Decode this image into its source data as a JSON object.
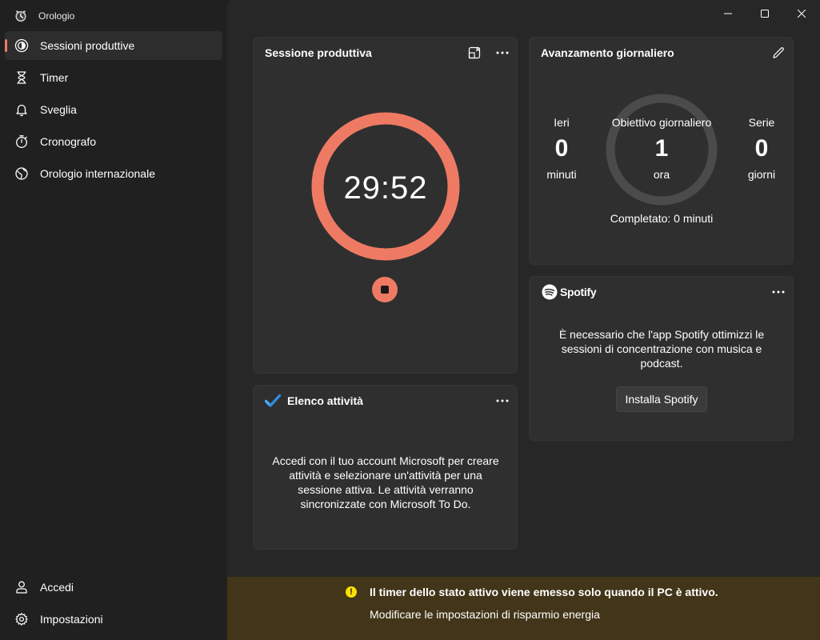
{
  "app": {
    "title": "Orologio"
  },
  "sidebar": {
    "items": [
      {
        "label": "Sessioni produttive",
        "icon": "focus-icon",
        "active": true
      },
      {
        "label": "Timer",
        "icon": "hourglass-icon"
      },
      {
        "label": "Sveglia",
        "icon": "bell-icon"
      },
      {
        "label": "Cronografo",
        "icon": "stopwatch-icon"
      },
      {
        "label": "Orologio internazionale",
        "icon": "globe-icon"
      }
    ],
    "bottom": [
      {
        "label": "Accedi",
        "icon": "person-icon"
      },
      {
        "label": "Impostazioni",
        "icon": "gear-icon"
      }
    ]
  },
  "session": {
    "title": "Sessione produttiva",
    "time": "29:52",
    "progress": 1.0,
    "ring_color": "#ef7a63"
  },
  "daily": {
    "title": "Avanzamento giornaliero",
    "yesterday": {
      "label": "Ieri",
      "value": "0",
      "unit": "minuti"
    },
    "goal": {
      "label": "Obiettivo giornaliero",
      "value": "1",
      "unit": "ora"
    },
    "streak": {
      "label": "Serie",
      "value": "0",
      "unit": "giorni"
    },
    "completed": "Completato: 0 minuti"
  },
  "spotify": {
    "brand": "Spotify",
    "message": "È necessario che l'app Spotify ottimizzi le sessioni di concentrazione con musica e podcast.",
    "install_label": "Installa Spotify"
  },
  "tasks": {
    "title": "Elenco attività",
    "message": "Accedi con il tuo account Microsoft per creare attività e selezionare un'attività per una sessione attiva. Le attività verranno sincronizzate con Microsoft To Do."
  },
  "banner": {
    "title": "Il timer dello stato attivo viene emesso solo quando il PC è attivo.",
    "link": "Modificare le impostazioni di risparmio energia"
  },
  "colors": {
    "accent": "#ef7a63",
    "warning": "#fce100",
    "banner_bg": "#433519"
  }
}
